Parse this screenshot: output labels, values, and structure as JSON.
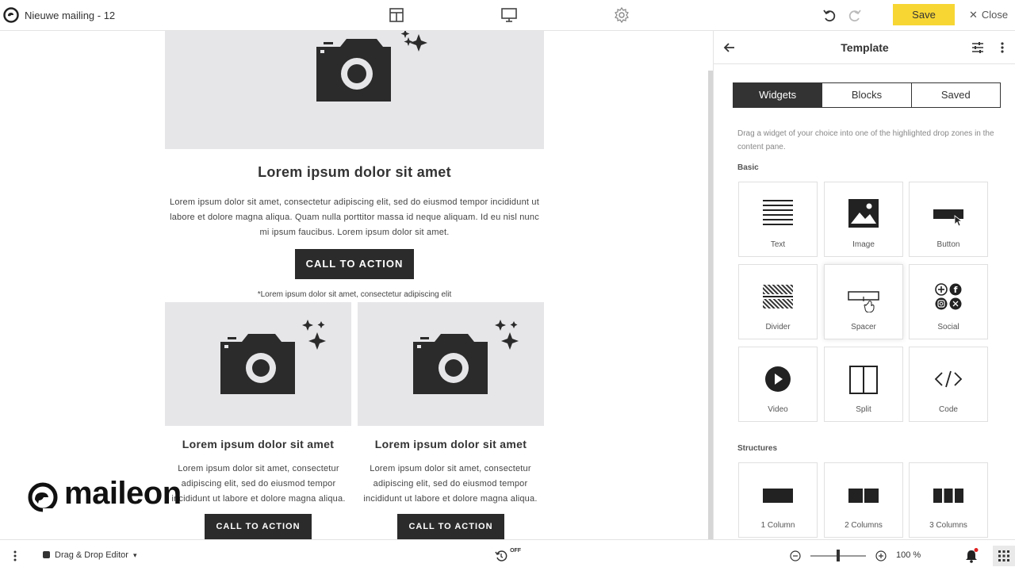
{
  "topbar": {
    "doc_title": "Nieuwe mailing - 12",
    "save_label": "Save",
    "close_label": "Close",
    "accent_color": "#f7d634"
  },
  "canvas": {
    "hero_heading": "Lorem ipsum dolor sit amet",
    "hero_body": "Lorem ipsum dolor sit amet, consectetur adipiscing elit, sed do eiusmod tempor incididunt ut labore et dolore magna aliqua. Quam nulla porttitor massa id neque aliquam. Id eu nisl nunc mi ipsum faucibus. Lorem ipsum dolor sit amet.",
    "hero_cta": "CALL TO ACTION",
    "note": "*Lorem ipsum dolor sit amet, consectetur adipiscing elit",
    "columns": [
      {
        "heading": "Lorem ipsum dolor sit amet",
        "body": "Lorem ipsum dolor sit amet, consectetur adipiscing elit, sed do eiusmod tempor incididunt ut labore et dolore magna aliqua.",
        "cta": "CALL TO ACTION"
      },
      {
        "heading": "Lorem ipsum dolor sit amet",
        "body": "Lorem ipsum dolor sit amet, consectetur adipiscing elit, sed do eiusmod tempor incididunt ut labore et dolore magna aliqua.",
        "cta": "CALL TO ACTION"
      }
    ],
    "brand": "maileon"
  },
  "panel": {
    "title": "Template",
    "tabs": [
      "Widgets",
      "Blocks",
      "Saved"
    ],
    "active_tab": "Widgets",
    "hint": "Drag a widget of your choice into one of the highlighted drop zones in the content pane.",
    "basic_label": "Basic",
    "widgets": [
      {
        "label": "Text",
        "icon": "text-icon"
      },
      {
        "label": "Image",
        "icon": "image-icon"
      },
      {
        "label": "Button",
        "icon": "button-icon"
      },
      {
        "label": "Divider",
        "icon": "divider-icon"
      },
      {
        "label": "Spacer",
        "icon": "spacer-icon"
      },
      {
        "label": "Social",
        "icon": "social-icon"
      },
      {
        "label": "Video",
        "icon": "video-icon"
      },
      {
        "label": "Split",
        "icon": "split-icon"
      },
      {
        "label": "Code",
        "icon": "code-icon"
      }
    ],
    "structures_label": "Structures",
    "structures": [
      {
        "label": "1 Column",
        "icon": "one-column-icon"
      },
      {
        "label": "2 Columns",
        "icon": "two-columns-icon"
      },
      {
        "label": "3 Columns",
        "icon": "three-columns-icon"
      }
    ]
  },
  "bottombar": {
    "editor_label": "Drag & Drop Editor",
    "autosave_label": "OFF",
    "zoom": "100 %"
  }
}
